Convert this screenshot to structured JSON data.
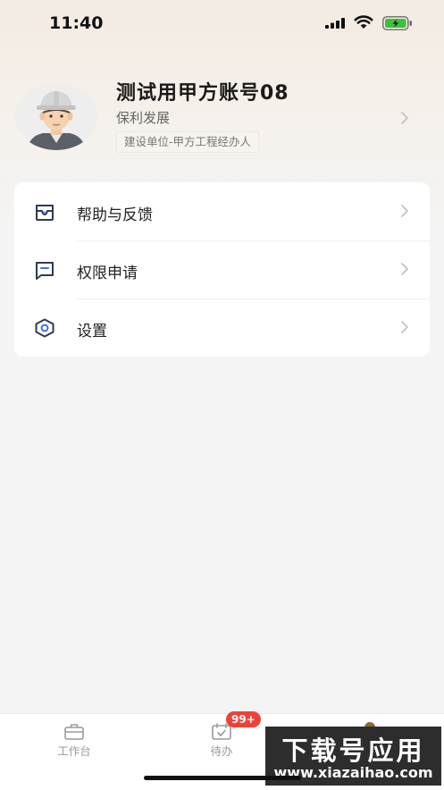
{
  "status_bar": {
    "time": "11:40"
  },
  "profile": {
    "name": "测试用甲方账号08",
    "company": "保利发展",
    "role": "建设单位-甲方工程经办人"
  },
  "menu": {
    "items": [
      {
        "label": "帮助与反馈",
        "icon": "message-box-icon"
      },
      {
        "label": "权限申请",
        "icon": "flag-bookmark-icon"
      },
      {
        "label": "设置",
        "icon": "settings-hexagon-icon"
      }
    ]
  },
  "tab_bar": {
    "tabs": [
      {
        "label": "工作台",
        "icon": "briefcase-icon"
      },
      {
        "label": "待办",
        "icon": "calendar-check-icon",
        "badge": "99+"
      }
    ]
  },
  "watermark": {
    "main": "下载号应用",
    "sub": "www.xiazaihao.com"
  },
  "colors": {
    "accent": "#f04138",
    "background": "#f4f4f4",
    "card": "#ffffff"
  }
}
